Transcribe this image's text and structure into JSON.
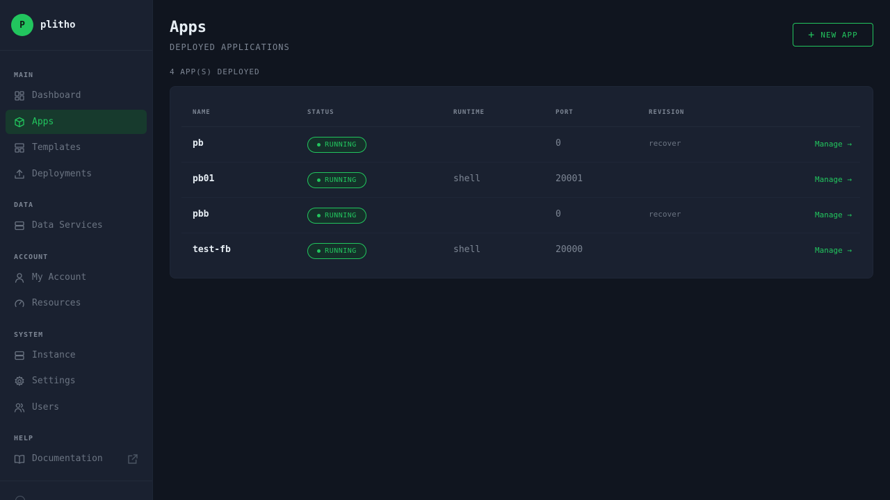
{
  "brand": {
    "avatar_letter": "P",
    "name": "plitho"
  },
  "sidebar": {
    "sections": {
      "main": "MAIN",
      "data": "DATA",
      "account": "ACCOUNT",
      "system": "SYSTEM",
      "help": "HELP"
    },
    "items": {
      "dashboard": "Dashboard",
      "apps": "Apps",
      "templates": "Templates",
      "deployments": "Deployments",
      "data_services": "Data Services",
      "my_account": "My Account",
      "resources": "Resources",
      "instance": "Instance",
      "settings": "Settings",
      "users": "Users",
      "documentation": "Documentation"
    },
    "active_item": "apps"
  },
  "page": {
    "title": "Apps",
    "subtitle": "DEPLOYED APPLICATIONS",
    "new_app_label": "NEW APP",
    "count_label": "4 APP(S) DEPLOYED"
  },
  "table": {
    "headers": {
      "name": "NAME",
      "status": "STATUS",
      "runtime": "RUNTIME",
      "port": "PORT",
      "revision": "REVISION"
    },
    "rows": [
      {
        "name": "pb",
        "status": "RUNNING",
        "runtime": "",
        "port": "0",
        "revision": "recover",
        "action": "Manage →"
      },
      {
        "name": "pb01",
        "status": "RUNNING",
        "runtime": "shell",
        "port": "20001",
        "revision": "",
        "action": "Manage →"
      },
      {
        "name": "pbb",
        "status": "RUNNING",
        "runtime": "",
        "port": "0",
        "revision": "recover",
        "action": "Manage →"
      },
      {
        "name": "test-fb",
        "status": "RUNNING",
        "runtime": "shell",
        "port": "20000",
        "revision": "",
        "action": "Manage →"
      }
    ]
  },
  "colors": {
    "accent": "#22c55e",
    "background": "#10151f",
    "sidebar": "#1a2130",
    "muted_text": "#7d8694"
  }
}
